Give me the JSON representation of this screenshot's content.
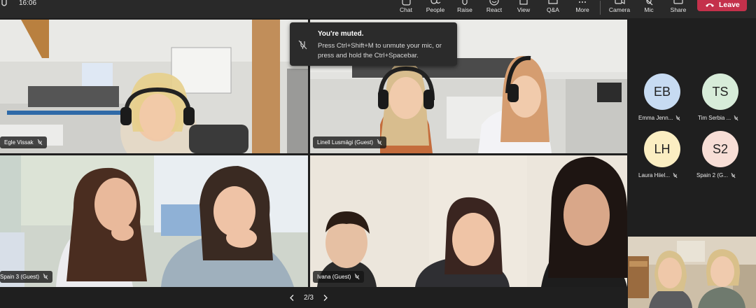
{
  "statusbar": {
    "time": "16:06"
  },
  "toolbar": {
    "chat": "Chat",
    "people": "People",
    "raise": "Raise",
    "react": "React",
    "view": "View",
    "qa": "Q&A",
    "more": "More",
    "camera": "Camera",
    "mic": "Mic",
    "share": "Share",
    "leave": "Leave"
  },
  "toast": {
    "title": "You're muted.",
    "body": "Press Ctrl+Shift+M to unmute your mic, or press and hold the Ctrl+Spacebar."
  },
  "tiles": [
    {
      "name": "Egle Vissak"
    },
    {
      "name": "Linell Lusmägi (Guest)"
    },
    {
      "name": "Spain 3 (Guest)"
    },
    {
      "name": "Ivana (Guest)"
    }
  ],
  "participants": [
    {
      "initials": "EB",
      "name": "Emma Jenn...",
      "color": "#c7dbf2"
    },
    {
      "initials": "TS",
      "name": "Tim Serbia ...",
      "color": "#d7ecd9"
    },
    {
      "initials": "LH",
      "name": "Laura Hiiel...",
      "color": "#fbeec2"
    },
    {
      "initials": "S2",
      "name": "Spain 2 (G...",
      "color": "#f7ded6"
    }
  ],
  "pager": {
    "label": "2/3"
  },
  "colors": {
    "leave": "#c4314b",
    "background": "#1f1f1f",
    "toolbar": "#292929"
  }
}
